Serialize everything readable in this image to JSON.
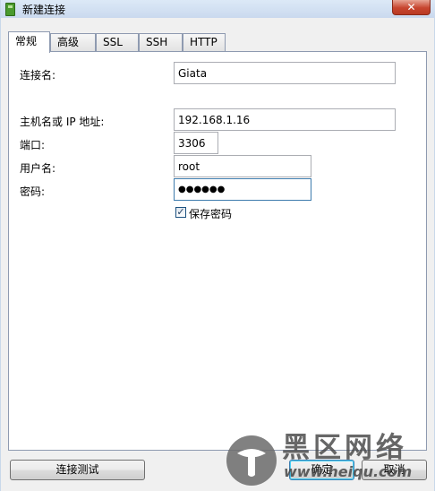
{
  "window": {
    "title": "新建连接",
    "close_glyph": "✕"
  },
  "tabs": [
    {
      "label": "常规",
      "active": true
    },
    {
      "label": "高级",
      "active": false
    },
    {
      "label": "SSL",
      "active": false
    },
    {
      "label": "SSH",
      "active": false
    },
    {
      "label": "HTTP",
      "active": false
    }
  ],
  "form": {
    "connection_name": {
      "label": "连接名:",
      "value": "Giata"
    },
    "host": {
      "label": "主机名或 IP 地址:",
      "value": "192.168.1.16"
    },
    "port": {
      "label": "端口:",
      "value": "3306"
    },
    "username": {
      "label": "用户名:",
      "value": "root"
    },
    "password": {
      "label": "密码:",
      "value": "●●●●●●"
    },
    "save_password": {
      "label": "保存密码",
      "checked": true,
      "glyph": "✓"
    }
  },
  "buttons": {
    "test_connection": "连接测试",
    "ok": "确定",
    "cancel": "取消"
  },
  "watermark": {
    "text": "黑区网络",
    "url": "www.heiqu.com"
  },
  "colors": {
    "title_bar": "#cad9ee",
    "close_button": "#c7452f",
    "focus_border": "#3d7bad",
    "logo_gray": "#6b6b6b"
  }
}
